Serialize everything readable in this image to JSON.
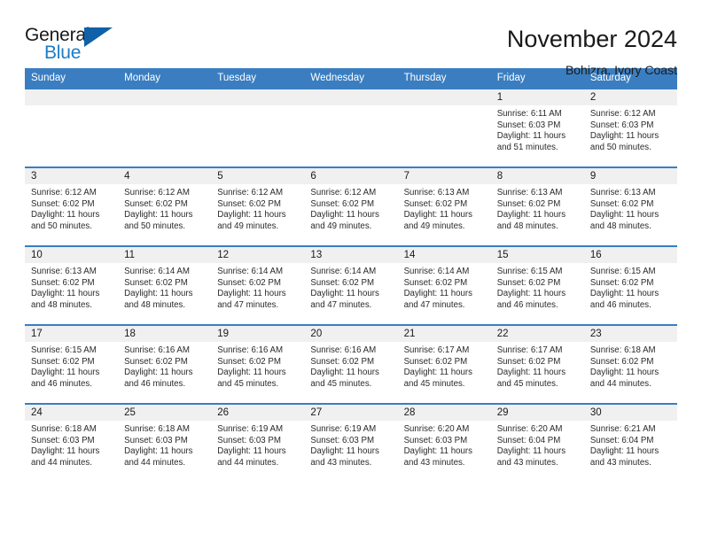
{
  "brand": {
    "name_part1": "General",
    "name_part2": "Blue",
    "triangle_color": "#1161a8",
    "blue_text_color": "#1e7bc4"
  },
  "header": {
    "title": "November 2024",
    "subtitle": "Bohizra, Ivory Coast",
    "accent_color": "#3a7ec1",
    "daynum_band_color": "#f0f0f0"
  },
  "weekday_headers": [
    "Sunday",
    "Monday",
    "Tuesday",
    "Wednesday",
    "Thursday",
    "Friday",
    "Saturday"
  ],
  "weeks": [
    [
      {
        "day": "",
        "sunrise": "",
        "sunset": "",
        "daylight_line1": "",
        "daylight_line2": ""
      },
      {
        "day": "",
        "sunrise": "",
        "sunset": "",
        "daylight_line1": "",
        "daylight_line2": ""
      },
      {
        "day": "",
        "sunrise": "",
        "sunset": "",
        "daylight_line1": "",
        "daylight_line2": ""
      },
      {
        "day": "",
        "sunrise": "",
        "sunset": "",
        "daylight_line1": "",
        "daylight_line2": ""
      },
      {
        "day": "",
        "sunrise": "",
        "sunset": "",
        "daylight_line1": "",
        "daylight_line2": ""
      },
      {
        "day": "1",
        "sunrise": "Sunrise: 6:11 AM",
        "sunset": "Sunset: 6:03 PM",
        "daylight_line1": "Daylight: 11 hours",
        "daylight_line2": "and 51 minutes."
      },
      {
        "day": "2",
        "sunrise": "Sunrise: 6:12 AM",
        "sunset": "Sunset: 6:03 PM",
        "daylight_line1": "Daylight: 11 hours",
        "daylight_line2": "and 50 minutes."
      }
    ],
    [
      {
        "day": "3",
        "sunrise": "Sunrise: 6:12 AM",
        "sunset": "Sunset: 6:02 PM",
        "daylight_line1": "Daylight: 11 hours",
        "daylight_line2": "and 50 minutes."
      },
      {
        "day": "4",
        "sunrise": "Sunrise: 6:12 AM",
        "sunset": "Sunset: 6:02 PM",
        "daylight_line1": "Daylight: 11 hours",
        "daylight_line2": "and 50 minutes."
      },
      {
        "day": "5",
        "sunrise": "Sunrise: 6:12 AM",
        "sunset": "Sunset: 6:02 PM",
        "daylight_line1": "Daylight: 11 hours",
        "daylight_line2": "and 49 minutes."
      },
      {
        "day": "6",
        "sunrise": "Sunrise: 6:12 AM",
        "sunset": "Sunset: 6:02 PM",
        "daylight_line1": "Daylight: 11 hours",
        "daylight_line2": "and 49 minutes."
      },
      {
        "day": "7",
        "sunrise": "Sunrise: 6:13 AM",
        "sunset": "Sunset: 6:02 PM",
        "daylight_line1": "Daylight: 11 hours",
        "daylight_line2": "and 49 minutes."
      },
      {
        "day": "8",
        "sunrise": "Sunrise: 6:13 AM",
        "sunset": "Sunset: 6:02 PM",
        "daylight_line1": "Daylight: 11 hours",
        "daylight_line2": "and 48 minutes."
      },
      {
        "day": "9",
        "sunrise": "Sunrise: 6:13 AM",
        "sunset": "Sunset: 6:02 PM",
        "daylight_line1": "Daylight: 11 hours",
        "daylight_line2": "and 48 minutes."
      }
    ],
    [
      {
        "day": "10",
        "sunrise": "Sunrise: 6:13 AM",
        "sunset": "Sunset: 6:02 PM",
        "daylight_line1": "Daylight: 11 hours",
        "daylight_line2": "and 48 minutes."
      },
      {
        "day": "11",
        "sunrise": "Sunrise: 6:14 AM",
        "sunset": "Sunset: 6:02 PM",
        "daylight_line1": "Daylight: 11 hours",
        "daylight_line2": "and 48 minutes."
      },
      {
        "day": "12",
        "sunrise": "Sunrise: 6:14 AM",
        "sunset": "Sunset: 6:02 PM",
        "daylight_line1": "Daylight: 11 hours",
        "daylight_line2": "and 47 minutes."
      },
      {
        "day": "13",
        "sunrise": "Sunrise: 6:14 AM",
        "sunset": "Sunset: 6:02 PM",
        "daylight_line1": "Daylight: 11 hours",
        "daylight_line2": "and 47 minutes."
      },
      {
        "day": "14",
        "sunrise": "Sunrise: 6:14 AM",
        "sunset": "Sunset: 6:02 PM",
        "daylight_line1": "Daylight: 11 hours",
        "daylight_line2": "and 47 minutes."
      },
      {
        "day": "15",
        "sunrise": "Sunrise: 6:15 AM",
        "sunset": "Sunset: 6:02 PM",
        "daylight_line1": "Daylight: 11 hours",
        "daylight_line2": "and 46 minutes."
      },
      {
        "day": "16",
        "sunrise": "Sunrise: 6:15 AM",
        "sunset": "Sunset: 6:02 PM",
        "daylight_line1": "Daylight: 11 hours",
        "daylight_line2": "and 46 minutes."
      }
    ],
    [
      {
        "day": "17",
        "sunrise": "Sunrise: 6:15 AM",
        "sunset": "Sunset: 6:02 PM",
        "daylight_line1": "Daylight: 11 hours",
        "daylight_line2": "and 46 minutes."
      },
      {
        "day": "18",
        "sunrise": "Sunrise: 6:16 AM",
        "sunset": "Sunset: 6:02 PM",
        "daylight_line1": "Daylight: 11 hours",
        "daylight_line2": "and 46 minutes."
      },
      {
        "day": "19",
        "sunrise": "Sunrise: 6:16 AM",
        "sunset": "Sunset: 6:02 PM",
        "daylight_line1": "Daylight: 11 hours",
        "daylight_line2": "and 45 minutes."
      },
      {
        "day": "20",
        "sunrise": "Sunrise: 6:16 AM",
        "sunset": "Sunset: 6:02 PM",
        "daylight_line1": "Daylight: 11 hours",
        "daylight_line2": "and 45 minutes."
      },
      {
        "day": "21",
        "sunrise": "Sunrise: 6:17 AM",
        "sunset": "Sunset: 6:02 PM",
        "daylight_line1": "Daylight: 11 hours",
        "daylight_line2": "and 45 minutes."
      },
      {
        "day": "22",
        "sunrise": "Sunrise: 6:17 AM",
        "sunset": "Sunset: 6:02 PM",
        "daylight_line1": "Daylight: 11 hours",
        "daylight_line2": "and 45 minutes."
      },
      {
        "day": "23",
        "sunrise": "Sunrise: 6:18 AM",
        "sunset": "Sunset: 6:02 PM",
        "daylight_line1": "Daylight: 11 hours",
        "daylight_line2": "and 44 minutes."
      }
    ],
    [
      {
        "day": "24",
        "sunrise": "Sunrise: 6:18 AM",
        "sunset": "Sunset: 6:03 PM",
        "daylight_line1": "Daylight: 11 hours",
        "daylight_line2": "and 44 minutes."
      },
      {
        "day": "25",
        "sunrise": "Sunrise: 6:18 AM",
        "sunset": "Sunset: 6:03 PM",
        "daylight_line1": "Daylight: 11 hours",
        "daylight_line2": "and 44 minutes."
      },
      {
        "day": "26",
        "sunrise": "Sunrise: 6:19 AM",
        "sunset": "Sunset: 6:03 PM",
        "daylight_line1": "Daylight: 11 hours",
        "daylight_line2": "and 44 minutes."
      },
      {
        "day": "27",
        "sunrise": "Sunrise: 6:19 AM",
        "sunset": "Sunset: 6:03 PM",
        "daylight_line1": "Daylight: 11 hours",
        "daylight_line2": "and 43 minutes."
      },
      {
        "day": "28",
        "sunrise": "Sunrise: 6:20 AM",
        "sunset": "Sunset: 6:03 PM",
        "daylight_line1": "Daylight: 11 hours",
        "daylight_line2": "and 43 minutes."
      },
      {
        "day": "29",
        "sunrise": "Sunrise: 6:20 AM",
        "sunset": "Sunset: 6:04 PM",
        "daylight_line1": "Daylight: 11 hours",
        "daylight_line2": "and 43 minutes."
      },
      {
        "day": "30",
        "sunrise": "Sunrise: 6:21 AM",
        "sunset": "Sunset: 6:04 PM",
        "daylight_line1": "Daylight: 11 hours",
        "daylight_line2": "and 43 minutes."
      }
    ]
  ]
}
